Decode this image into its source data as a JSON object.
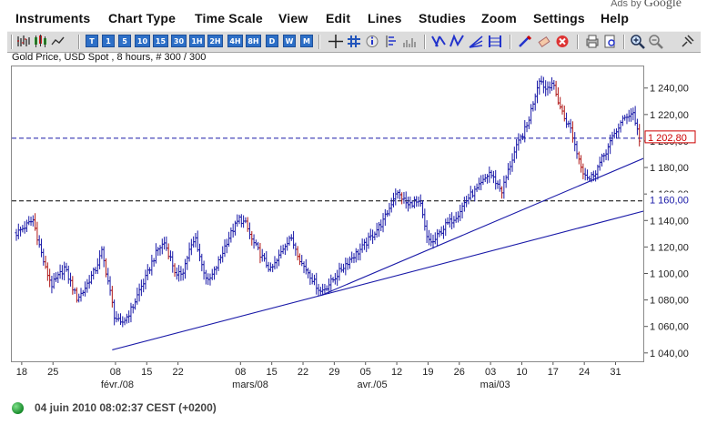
{
  "ads_label": "Ads by",
  "ads_brand": "Google",
  "menu": [
    "Instruments",
    "Chart Type",
    "Time Scale",
    "View",
    "Edit",
    "Lines",
    "Studies",
    "Zoom",
    "Settings",
    "Help"
  ],
  "toolbar": {
    "period_buttons": [
      "T",
      "1",
      "5",
      "10",
      "15",
      "30",
      "1H",
      "2H",
      "4H",
      "8H",
      "D",
      "W",
      "M"
    ],
    "icons": [
      "bar-chart-icon",
      "candlestick-icon",
      "line-chart-icon",
      "crosshair-icon",
      "grid-icon",
      "info-icon",
      "scale-icon",
      "volume-icon",
      "trend-down-icon",
      "trend-up-icon",
      "fan-icon",
      "fibonacci-icon",
      "draw-icon",
      "eraser-icon",
      "delete-icon",
      "print-icon",
      "preview-icon",
      "zoom-in-icon",
      "zoom-out-icon",
      "pin-icon"
    ]
  },
  "chart_title": "Gold Price, USD Spot , 8 hours, # 300 / 300",
  "status": {
    "time": "04 juin 2010 08:02:37  CEST (+0200)"
  },
  "colors": {
    "bars": "#1a1aa8",
    "down_bars": "#b01818",
    "trendline": "#1a1aa8",
    "price_tag": "#cc0000"
  },
  "chart_data": {
    "type": "ohlc-bar",
    "title": "Gold Price, USD Spot , 8 hours, # 300 / 300",
    "ylim": [
      1033,
      1257
    ],
    "y_ticks": [
      1040,
      1060,
      1080,
      1100,
      1120,
      1140,
      1160,
      1180,
      1200,
      1220,
      1240
    ],
    "y_tick_labels": [
      "1 040,00",
      "1 060,00",
      "1 080,00",
      "1 100,00",
      "1 120,00",
      "1 140,00",
      "1 160,00",
      "1 180,00",
      "1 200,00",
      "1 220,00",
      "1 240,00"
    ],
    "x_ticks": [
      {
        "label": "18",
        "i": 3
      },
      {
        "label": "25",
        "i": 18
      },
      {
        "label": "08",
        "i": 48
      },
      {
        "label": "15",
        "i": 63
      },
      {
        "label": "22",
        "i": 78
      },
      {
        "label": "08",
        "i": 108
      },
      {
        "label": "15",
        "i": 123
      },
      {
        "label": "22",
        "i": 138
      },
      {
        "label": "29",
        "i": 153
      },
      {
        "label": "05",
        "i": 168
      },
      {
        "label": "12",
        "i": 183
      },
      {
        "label": "19",
        "i": 198
      },
      {
        "label": "26",
        "i": 213
      },
      {
        "label": "03",
        "i": 228
      },
      {
        "label": "10",
        "i": 243
      },
      {
        "label": "17",
        "i": 258
      },
      {
        "label": "24",
        "i": 273
      },
      {
        "label": "31",
        "i": 288
      }
    ],
    "x_month_labels": [
      {
        "label": "févr./08",
        "i": 41
      },
      {
        "label": "mars/08",
        "i": 104
      },
      {
        "label": "avr./05",
        "i": 164
      },
      {
        "label": "mai/03",
        "i": 223
      }
    ],
    "last_price": 1202.8,
    "last_price_label": "1 202,80",
    "horizontal_lines": [
      {
        "value": 1202.8,
        "color": "#1a1aa8"
      },
      {
        "value": 1155.5,
        "color": "#000000",
        "label": "1 160,00"
      }
    ],
    "trendlines": [
      {
        "from": {
          "i": 46,
          "v": 1043
        },
        "to": {
          "i": 299,
          "v": 1148
        }
      },
      {
        "from": {
          "i": 146,
          "v": 1084
        },
        "to": {
          "i": 299,
          "v": 1188
        }
      }
    ],
    "keypoints": [
      [
        0,
        1131
      ],
      [
        4,
        1136
      ],
      [
        8,
        1141
      ],
      [
        11,
        1122
      ],
      [
        14,
        1104
      ],
      [
        17,
        1092
      ],
      [
        20,
        1098
      ],
      [
        23,
        1105
      ],
      [
        26,
        1094
      ],
      [
        29,
        1082
      ],
      [
        32,
        1087
      ],
      [
        35,
        1096
      ],
      [
        38,
        1104
      ],
      [
        41,
        1117
      ],
      [
        44,
        1095
      ],
      [
        47,
        1069
      ],
      [
        50,
        1062
      ],
      [
        53,
        1068
      ],
      [
        56,
        1076
      ],
      [
        59,
        1088
      ],
      [
        62,
        1097
      ],
      [
        65,
        1109
      ],
      [
        68,
        1119
      ],
      [
        71,
        1124
      ],
      [
        74,
        1112
      ],
      [
        77,
        1098
      ],
      [
        80,
        1103
      ],
      [
        83,
        1118
      ],
      [
        86,
        1127
      ],
      [
        89,
        1107
      ],
      [
        92,
        1094
      ],
      [
        95,
        1102
      ],
      [
        98,
        1113
      ],
      [
        101,
        1125
      ],
      [
        104,
        1134
      ],
      [
        107,
        1142
      ],
      [
        110,
        1138
      ],
      [
        113,
        1126
      ],
      [
        116,
        1118
      ],
      [
        119,
        1110
      ],
      [
        122,
        1103
      ],
      [
        125,
        1110
      ],
      [
        128,
        1120
      ],
      [
        131,
        1128
      ],
      [
        134,
        1120
      ],
      [
        137,
        1108
      ],
      [
        140,
        1102
      ],
      [
        143,
        1094
      ],
      [
        146,
        1087
      ],
      [
        149,
        1091
      ],
      [
        152,
        1096
      ],
      [
        155,
        1102
      ],
      [
        158,
        1108
      ],
      [
        161,
        1113
      ],
      [
        164,
        1117
      ],
      [
        167,
        1122
      ],
      [
        170,
        1128
      ],
      [
        173,
        1134
      ],
      [
        176,
        1140
      ],
      [
        179,
        1150
      ],
      [
        182,
        1162
      ],
      [
        185,
        1158
      ],
      [
        188,
        1152
      ],
      [
        191,
        1155
      ],
      [
        194,
        1152
      ],
      [
        197,
        1127
      ],
      [
        200,
        1124
      ],
      [
        203,
        1131
      ],
      [
        206,
        1137
      ],
      [
        209,
        1141
      ],
      [
        212,
        1146
      ],
      [
        215,
        1154
      ],
      [
        218,
        1160
      ],
      [
        221,
        1164
      ],
      [
        224,
        1170
      ],
      [
        227,
        1177
      ],
      [
        230,
        1170
      ],
      [
        233,
        1163
      ],
      [
        236,
        1178
      ],
      [
        239,
        1192
      ],
      [
        242,
        1203
      ],
      [
        245,
        1212
      ],
      [
        248,
        1230
      ],
      [
        251,
        1248
      ],
      [
        254,
        1240
      ],
      [
        257,
        1245
      ],
      [
        260,
        1231
      ],
      [
        263,
        1218
      ],
      [
        266,
        1210
      ],
      [
        269,
        1192
      ],
      [
        272,
        1178
      ],
      [
        275,
        1172
      ],
      [
        278,
        1178
      ],
      [
        281,
        1187
      ],
      [
        284,
        1196
      ],
      [
        287,
        1206
      ],
      [
        290,
        1214
      ],
      [
        293,
        1220
      ],
      [
        296,
        1222
      ],
      [
        299,
        1202
      ]
    ]
  }
}
